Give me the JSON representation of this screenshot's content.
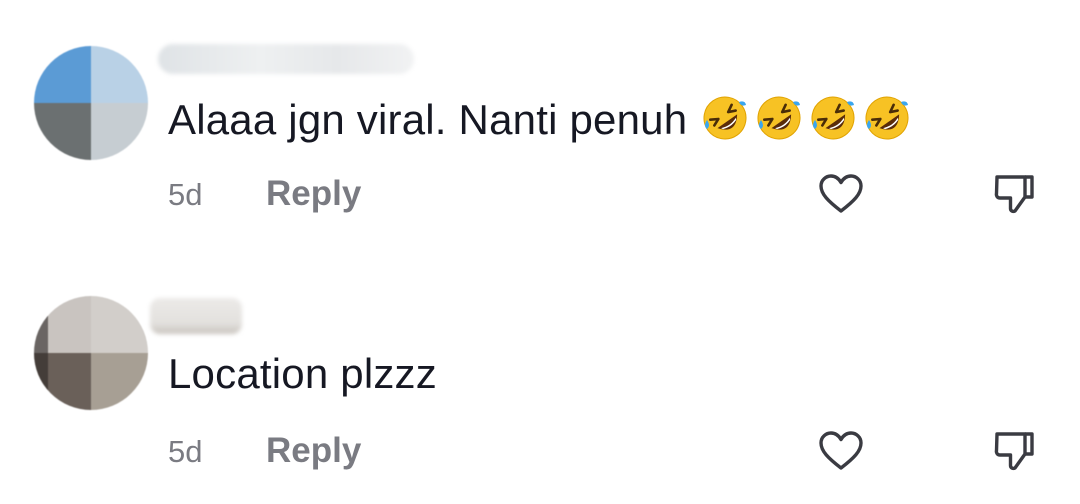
{
  "comments": [
    {
      "text": "Alaaa jgn viral. Nanti penuh",
      "emojis": [
        "rolling-on-floor-laughing",
        "rolling-on-floor-laughing",
        "rolling-on-floor-laughing",
        "rolling-on-floor-laughing"
      ],
      "time": "5d",
      "reply_label": "Reply",
      "like_icon": "heart-outline-icon",
      "dislike_icon": "thumbs-down-outline-icon"
    },
    {
      "text": "Location plzzz",
      "time": "5d",
      "reply_label": "Reply",
      "like_icon": "heart-outline-icon",
      "dislike_icon": "thumbs-down-outline-icon"
    }
  ],
  "colors": {
    "text_primary": "#161823",
    "text_secondary": "#7a7b82",
    "icon_stroke": "#3a3b42"
  }
}
